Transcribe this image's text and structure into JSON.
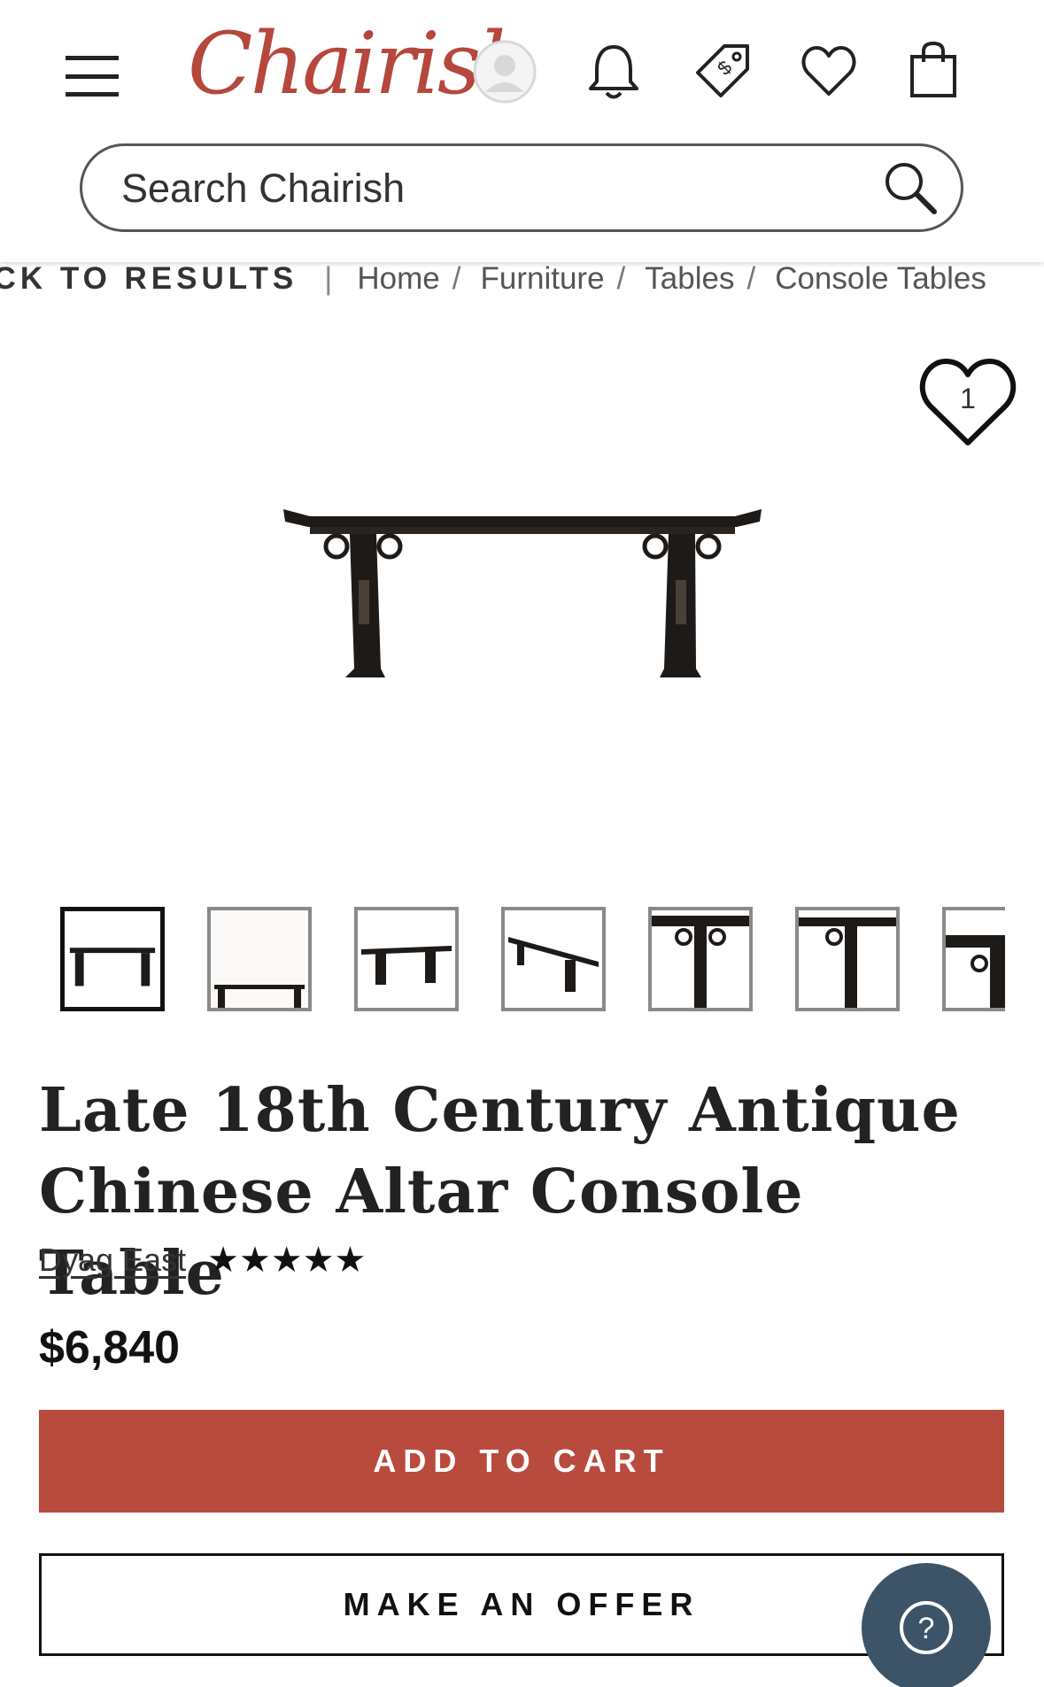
{
  "header": {
    "logo_text": "Chairish",
    "icons": [
      "menu-icon",
      "avatar-icon",
      "bell-icon",
      "price-tag-icon",
      "heart-icon",
      "shopping-bag-icon"
    ],
    "brand_color": "#b5473d"
  },
  "search": {
    "placeholder": "Search Chairish"
  },
  "breadcrumb": {
    "back_label": "BACK TO RESULTS",
    "separator": "|",
    "items": [
      "Home",
      "Furniture",
      "Tables",
      "Console Tables"
    ]
  },
  "favorite": {
    "count": "1"
  },
  "gallery": {
    "thumbnail_count": 7,
    "active_index": 0
  },
  "product": {
    "title": "Late 18th Century Antique Chinese Altar Console Table",
    "seller": "Dyag East",
    "stars": "★★★★★",
    "rating": 5,
    "price": "$6,840"
  },
  "actions": {
    "add_to_cart": "ADD TO CART",
    "make_offer": "MAKE AN OFFER",
    "add_to_cart_color": "#b84b3e"
  },
  "help": {
    "label": "?",
    "color": "#3d5468"
  }
}
